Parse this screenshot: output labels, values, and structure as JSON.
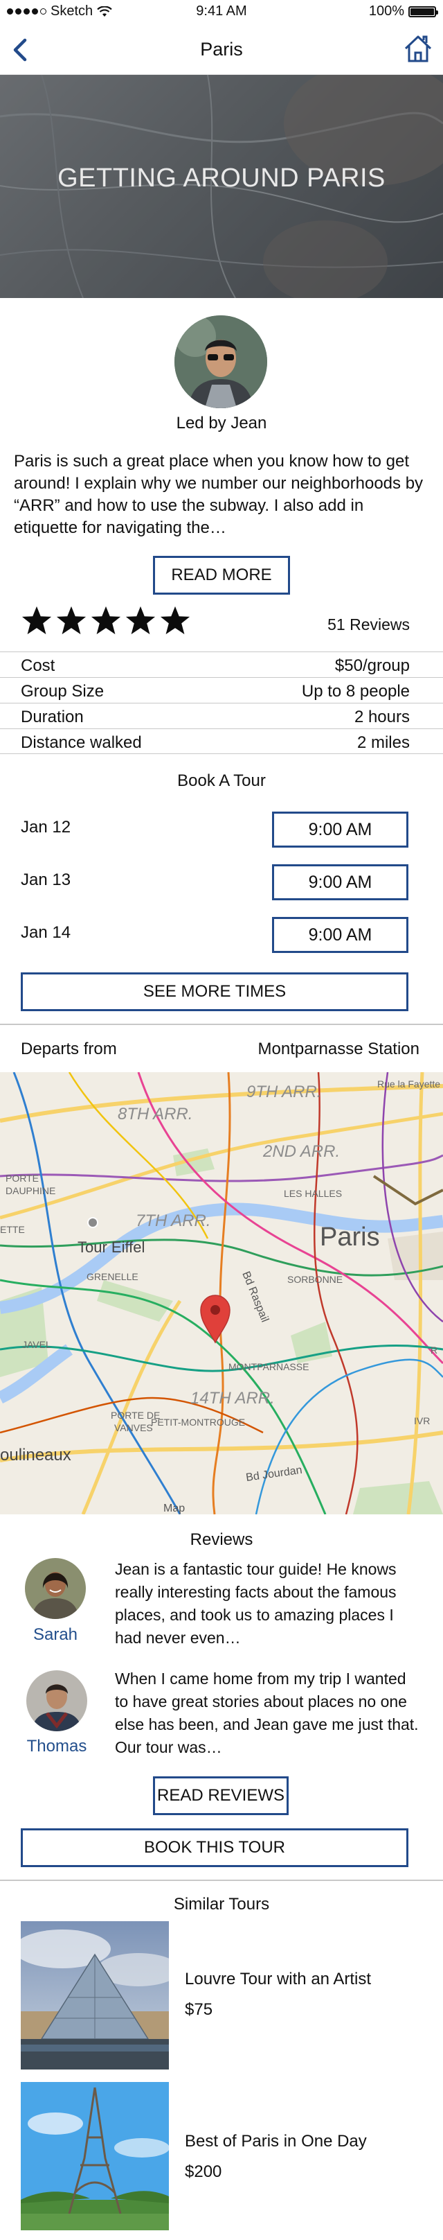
{
  "status_bar": {
    "carrier": "Sketch",
    "time": "9:41 AM",
    "battery": "100%"
  },
  "nav": {
    "title": "Paris",
    "back_icon": "chevron-left-icon",
    "home_icon": "home-icon"
  },
  "hero": {
    "heading": "GETTING AROUND PARIS"
  },
  "guide": {
    "led_by": "Led by Jean",
    "description": "Paris is such a great place when you know how to get around! I explain why we number our neighborhoods by “ARR” and how to use the subway. I also add in etiquette for navigating the…",
    "read_more": "READ MORE"
  },
  "rating": {
    "stars": 5,
    "reviews_count": "51 Reviews"
  },
  "details": [
    {
      "key": "Cost",
      "value": "$50/group"
    },
    {
      "key": "Group Size",
      "value": "Up to 8 people"
    },
    {
      "key": "Duration",
      "value": "2 hours"
    },
    {
      "key": "Distance walked",
      "value": "2 miles"
    }
  ],
  "booking": {
    "title": "Book A Tour",
    "slots": [
      {
        "date": "Jan 12",
        "time": "9:00 AM"
      },
      {
        "date": "Jan 13",
        "time": "9:00 AM"
      },
      {
        "date": "Jan 14",
        "time": "9:00 AM"
      }
    ],
    "see_more": "SEE MORE TIMES"
  },
  "departs": {
    "label": "Departs from",
    "value": "Montparnasse Station"
  },
  "map": {
    "labels": {
      "arr9": "9TH ARR.",
      "arr8": "8TH ARR.",
      "arr2": "2ND ARR.",
      "arr7": "7TH ARR.",
      "arr14": "14TH ARR.",
      "rue": "Rue la Fayette",
      "porte_dauphine": "PORTE\nDAUPHINE",
      "les_halles": "LES HALLES",
      "paris": "Paris",
      "ette": "ETTE",
      "tour_eiffel": "Tour Eiffel",
      "grenelle": "GRENELLE",
      "sorbonne": "SORBONNE",
      "bd_raspail": "Bd Raspail",
      "javel": "JAVEL",
      "montparnasse": "MONTPARNASSE",
      "porte_vanves": "PORTE DE\nVANVES",
      "petit_montrouge": "PETIT-MONTROUGE",
      "moulineaux": "oulineaux",
      "bd_jourdan": "Bd Jourdan",
      "r_left": "R",
      "map_bottom": "Map",
      "ivr": "IVR"
    }
  },
  "reviews": {
    "title": "Reviews",
    "items": [
      {
        "name": "Sarah",
        "text": "Jean is a fantastic tour guide! He knows really interesting facts about the famous places, and took us to amazing places I had never even…"
      },
      {
        "name": "Thomas",
        "text": "When I came home from my trip I wanted to have great stories about places no one else has been, and Jean gave me just that. Our tour was…"
      }
    ],
    "read_reviews": "READ REVIEWS",
    "book": "BOOK THIS TOUR"
  },
  "similar": {
    "title": "Similar Tours",
    "items": [
      {
        "name": "Louvre Tour with an Artist",
        "price": "$75"
      },
      {
        "name": "Best of Paris in One Day",
        "price": "$200"
      }
    ]
  },
  "colors": {
    "accent": "#224a8a",
    "link": "#234f8c",
    "map_pin": "#e0403a"
  }
}
